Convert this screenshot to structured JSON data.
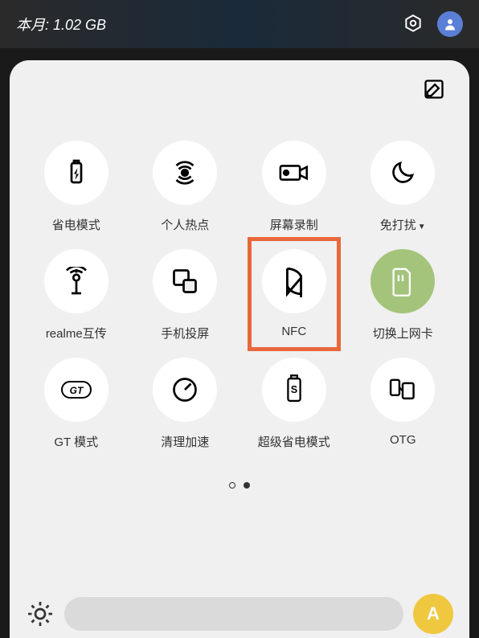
{
  "status": {
    "data_usage": "本月: 1.02 GB"
  },
  "tiles": {
    "battery_saver": "省电模式",
    "hotspot": "个人热点",
    "screen_record": "屏幕录制",
    "dnd": "免打扰",
    "realme_share": "realme互传",
    "cast": "手机投屏",
    "nfc": "NFC",
    "sim_switch": "切换上网卡",
    "gt_mode": "GT 模式",
    "cleanup": "清理加速",
    "super_saver": "超级省电模式",
    "otg": "OTG"
  },
  "auto_brightness": "A"
}
